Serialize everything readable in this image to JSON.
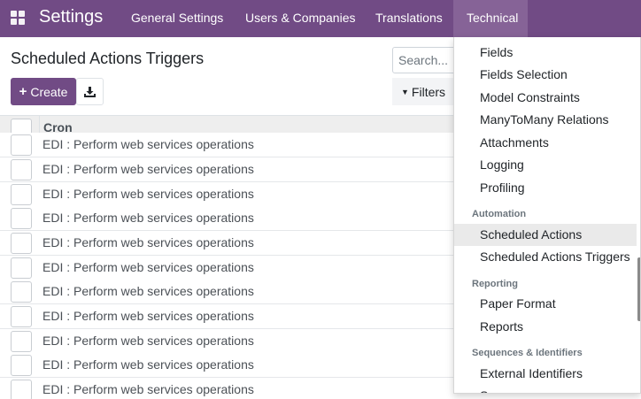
{
  "navbar": {
    "brand": "Settings",
    "items": [
      {
        "label": "General Settings"
      },
      {
        "label": "Users & Companies"
      },
      {
        "label": "Translations"
      },
      {
        "label": "Technical"
      }
    ]
  },
  "control_panel": {
    "title": "Scheduled Actions Triggers",
    "create_label": "Create",
    "search_placeholder": "Search...",
    "filters_label": "Filters"
  },
  "list": {
    "column_header": "Cron",
    "rows": [
      "EDI : Perform web services operations",
      "EDI : Perform web services operations",
      "EDI : Perform web services operations",
      "EDI : Perform web services operations",
      "EDI : Perform web services operations",
      "EDI : Perform web services operations",
      "EDI : Perform web services operations",
      "EDI : Perform web services operations",
      "EDI : Perform web services operations",
      "EDI : Perform web services operations",
      "EDI : Perform web services operations"
    ]
  },
  "technical_menu": {
    "items_top": [
      "Fields",
      "Fields Selection",
      "Model Constraints",
      "ManyToMany Relations",
      "Attachments",
      "Logging",
      "Profiling"
    ],
    "section_automation": "Automation",
    "automation_items": [
      "Scheduled Actions",
      "Scheduled Actions Triggers"
    ],
    "section_reporting": "Reporting",
    "reporting_items": [
      "Paper Format",
      "Reports"
    ],
    "section_sequences": "Sequences & Identifiers",
    "sequences_items": [
      "External Identifiers",
      "Sequences"
    ]
  },
  "colors": {
    "brand": "#714b85",
    "active_nav": "#866397",
    "highlight": "#eaeaea"
  }
}
